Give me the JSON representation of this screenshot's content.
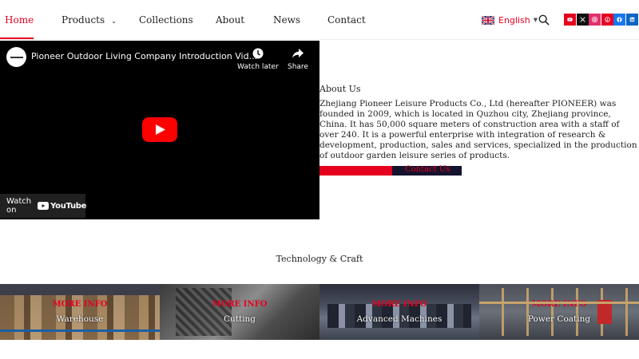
{
  "nav": {
    "items": [
      {
        "label": "Home",
        "active": true
      },
      {
        "label": "Products",
        "has_dropdown": true
      },
      {
        "label": "Collections"
      },
      {
        "label": "About"
      },
      {
        "label": "News"
      },
      {
        "label": "Contact"
      }
    ],
    "language": {
      "label": "English",
      "flag": "uk-flag-icon"
    },
    "search_icon": "search-icon",
    "socials": [
      {
        "name": "youtube-icon",
        "color": "#e5001e"
      },
      {
        "name": "x-twitter-icon",
        "color": "#111111"
      },
      {
        "name": "instagram-icon",
        "color": "#e1306c"
      },
      {
        "name": "pinterest-icon",
        "color": "#e60023"
      },
      {
        "name": "facebook-icon",
        "color": "#1877f2"
      },
      {
        "name": "linkedin-icon",
        "color": "#0a66c2"
      }
    ]
  },
  "video": {
    "title": "Pioneer Outdoor Living Company Introduction Vid...",
    "watch_later": "Watch later",
    "share": "Share",
    "watch_on": "Watch on",
    "youtube": "YouTube"
  },
  "about": {
    "title": "About Us",
    "text": "Zhejiang Pioneer Leisure Products Co., Ltd (hereafter PIONEER) was founded in 2009, which is located in Quzhou city, Zhejiang province, China. It has 50,000 square meters of construction area with a staff of over 240. It is a powerful enterprise with integration of research & development, production, sales and services, specialized in the production of outdoor garden leisure series of products.",
    "contact_button": "Contact Us"
  },
  "tech": {
    "title": "Technology & Craft",
    "cards": [
      {
        "more": "MORE INFO",
        "label": "Warehouse"
      },
      {
        "more": "MORE INFO",
        "label": "Cutting"
      },
      {
        "more": "MORE INFO",
        "label": "Advanced Machines"
      },
      {
        "more": "MORE INFO",
        "label": "Power Coating"
      }
    ]
  },
  "colors": {
    "accent": "#e5001e",
    "dark": "#14132e"
  }
}
